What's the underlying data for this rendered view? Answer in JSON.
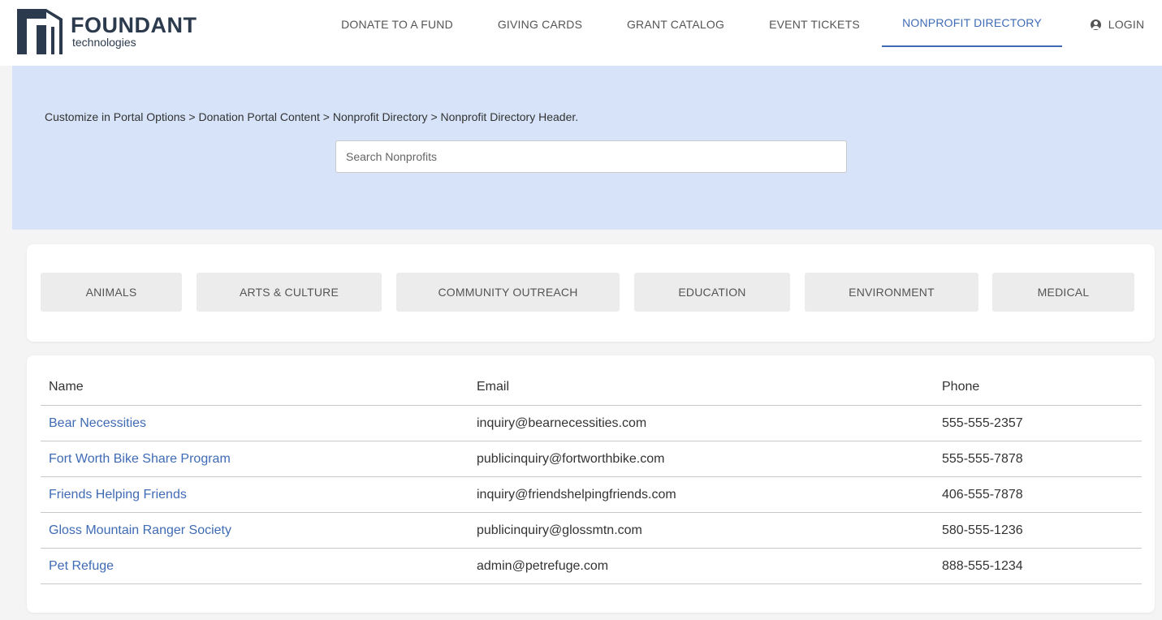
{
  "brand": {
    "name": "FOUNDANT",
    "sub": "technologies",
    "colors": {
      "navy": "#2b3a4c",
      "accent": "#3f6bb5",
      "banner": "#d6e3f8"
    }
  },
  "nav": {
    "items": [
      {
        "label": "DONATE TO A FUND"
      },
      {
        "label": "GIVING CARDS"
      },
      {
        "label": "GRANT CATALOG"
      },
      {
        "label": "EVENT TICKETS"
      },
      {
        "label": "NONPROFIT DIRECTORY",
        "active": true
      }
    ],
    "login": {
      "label": "LOGIN",
      "icon": "account-circle-icon"
    }
  },
  "banner": {
    "text": "Customize in Portal Options > Donation Portal Content > Nonprofit Directory > Nonprofit Directory Header.",
    "search_placeholder": "Search Nonprofits"
  },
  "categories": [
    {
      "label": "ANIMALS"
    },
    {
      "label": "ARTS & CULTURE"
    },
    {
      "label": "COMMUNITY OUTREACH"
    },
    {
      "label": "EDUCATION"
    },
    {
      "label": "ENVIRONMENT"
    },
    {
      "label": "MEDICAL"
    }
  ],
  "table": {
    "columns": [
      "Name",
      "Email",
      "Phone"
    ],
    "rows": [
      {
        "name": "Bear Necessities",
        "email": "inquiry@bearnecessities.com",
        "phone": "555-555-2357"
      },
      {
        "name": "Fort Worth Bike Share Program",
        "email": "publicinquiry@fortworthbike.com",
        "phone": "555-555-7878"
      },
      {
        "name": "Friends Helping Friends",
        "email": "inquiry@friendshelpingfriends.com",
        "phone": "406-555-7878"
      },
      {
        "name": "Gloss Mountain Ranger Society",
        "email": "publicinquiry@glossmtn.com",
        "phone": "580-555-1236"
      },
      {
        "name": "Pet Refuge",
        "email": "admin@petrefuge.com",
        "phone": "888-555-1234"
      }
    ]
  }
}
